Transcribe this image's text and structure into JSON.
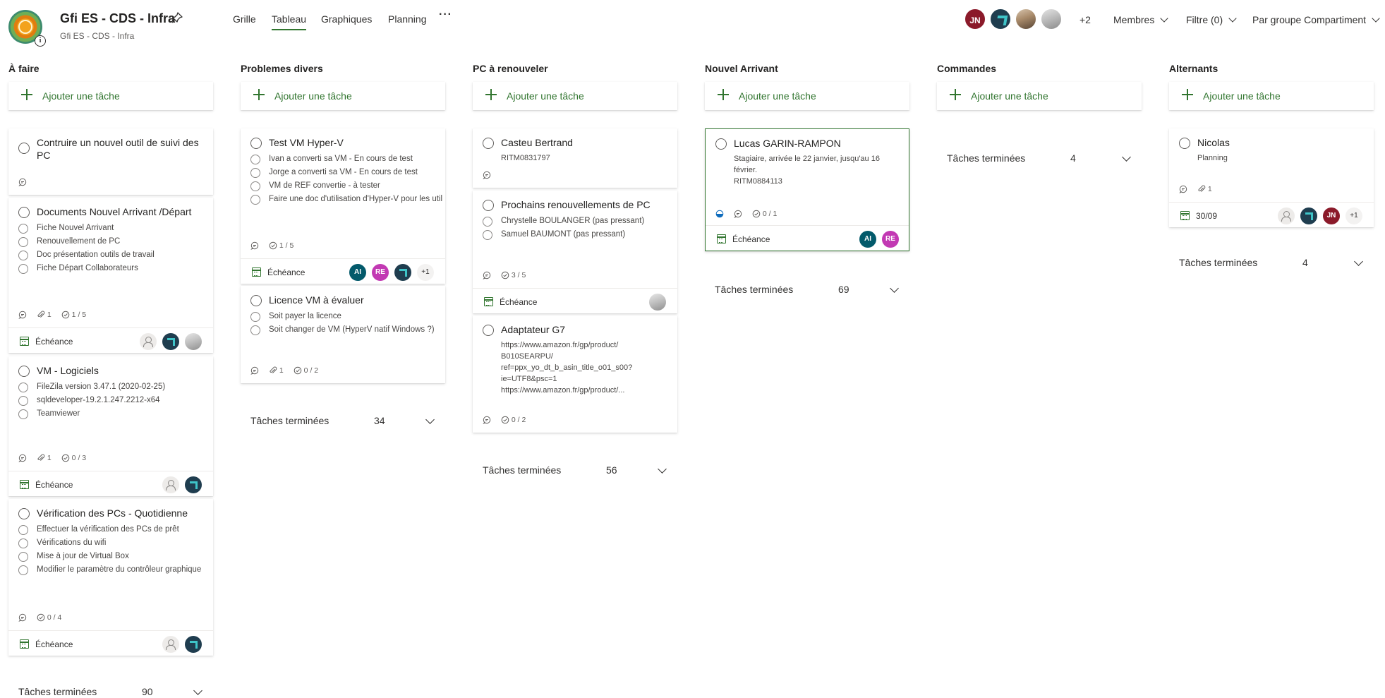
{
  "header": {
    "plan_title": "Gfi ES - CDS - Infra",
    "plan_subtitle": "Gfi ES - CDS - Infra",
    "tabs": [
      {
        "label": "Grille"
      },
      {
        "label": "Tableau",
        "active": true
      },
      {
        "label": "Graphiques"
      },
      {
        "label": "Planning"
      }
    ],
    "more_label": "···",
    "members": [
      {
        "initials": "JN",
        "color": "#8b1a2a"
      },
      {
        "initials": "",
        "icon": "company-logo"
      },
      {
        "initials": "",
        "icon": "photo"
      },
      {
        "initials": "",
        "icon": "photo"
      }
    ],
    "members_more": "+2",
    "members_label": "Membres",
    "filter_label": "Filtre (0)",
    "group_label": "Par groupe Compartiment"
  },
  "add_task_label": "Ajouter une tâche",
  "due_label": "Échéance",
  "done_label": "Tâches terminées",
  "columns": [
    {
      "title": "À faire",
      "done_count": "90",
      "cards": [
        {
          "title": "Contruire un nouvel outil de suivi des PC"
        },
        {
          "title": "Documents Nouvel Arrivant /Départ",
          "checklist": [
            "Fiche Nouvel Arrivant",
            "Renouvellement de PC",
            "Doc présentation outils de travail",
            "Fiche Départ Collaborateurs"
          ],
          "attachments": "1",
          "progress": "1 / 5"
        },
        {
          "title": "VM - Logiciels",
          "checklist": [
            "FileZila version 3.47.1 (2020-02-25)",
            "sqldeveloper-19.2.1.247.2212-x64",
            "Teamviewer"
          ],
          "attachments": "1",
          "progress": "0 / 3"
        },
        {
          "title": "Vérification des PCs - Quotidienne",
          "checklist": [
            "Effectuer la vérification des PCs de prêt",
            "Vérifications du wifi",
            "Mise à jour de Virtual Box",
            "Modifier le paramètre du contrôleur graphique"
          ],
          "progress": "0 / 4"
        }
      ]
    },
    {
      "title": "Problemes divers",
      "done_count": "34",
      "cards": [
        {
          "title": "Test VM Hyper-V",
          "checklist": [
            "Ivan a converti sa VM - En cours de test",
            "Jorge a converti sa VM - En cours de test",
            "VM de REF convertie - à tester",
            "Faire une doc d'utilisation d'Hyper-V pour les utilisateurs"
          ],
          "progress": "1 / 5",
          "assignees": [
            {
              "initials": "AI",
              "color": "#035a6b"
            },
            {
              "initials": "RE",
              "color": "#c239b3"
            }
          ],
          "assignees_more": "+1"
        },
        {
          "title": "Licence VM à évaluer",
          "checklist": [
            "Soit payer la licence",
            "Soit changer de VM (HyperV natif Windows ?)"
          ],
          "attachments": "1",
          "progress": "0 / 2"
        }
      ]
    },
    {
      "title": "PC à renouveler",
      "done_count": "56",
      "cards": [
        {
          "title": "Casteu Bertrand",
          "note": "RITM0831797"
        },
        {
          "title": "Prochains renouvellements de PC",
          "checklist": [
            "Chrystelle BOULANGER (pas pressant)",
            "Samuel BAUMONT (pas pressant)"
          ],
          "progress": "3 / 5"
        },
        {
          "title": "Adaptateur G7",
          "note": "https://www.amazon.fr/gp/product/\nB010SEARPU/\nref=ppx_yo_dt_b_asin_title_o01_s00?\nie=UTF8&psc=1\nhttps://www.amazon.fr/gp/product/...",
          "progress": "0 / 2"
        }
      ]
    },
    {
      "title": "Nouvel Arrivant",
      "done_count": "69",
      "cards": [
        {
          "title": "Lucas GARIN-RAMPON",
          "note": "Stagiaire, arrivée le 22 janvier, jusqu'au 16\nfévrier.\nRITM0884113",
          "progress": "0 / 1",
          "assignees": [
            {
              "initials": "AI",
              "color": "#035a6b"
            },
            {
              "initials": "RE",
              "color": "#c239b3"
            }
          ]
        }
      ]
    },
    {
      "title": "Commandes",
      "done_count": "4",
      "cards": []
    },
    {
      "title": "Alternants",
      "done_count": "4",
      "cards": [
        {
          "title": "Nicolas",
          "note": "Planning",
          "attachments": "1",
          "due_date": "30/09",
          "assignees": [
            {
              "initials": "JN",
              "color": "#8b1a2a"
            }
          ],
          "assignees_more": "+1"
        }
      ]
    }
  ],
  "colors": {
    "accent": "#31752f",
    "text": "#323130"
  }
}
